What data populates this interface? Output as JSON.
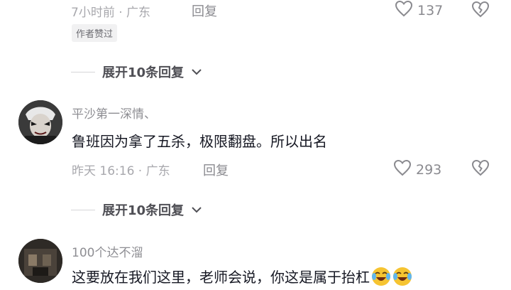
{
  "comment_top": {
    "meta": "7小时前 · 广东",
    "reply_label": "回复",
    "like_count": "137",
    "author_badge": "作者赞过"
  },
  "expand_1": {
    "label": "展开10条回复"
  },
  "comment_2": {
    "username": "平沙第一深情、",
    "content": "鲁班因为拿了五杀，极限翻盘。所以出名",
    "meta": "昨天 16:16 · 广东",
    "reply_label": "回复",
    "like_count": "293"
  },
  "expand_2": {
    "label": "展开10条回复"
  },
  "comment_3": {
    "username": "100个达不溜",
    "content": "这要放在我们这里，老师会说，你这是属于抬杠"
  },
  "colors": {
    "text_primary": "#161823",
    "text_meta": "#a8a8ad",
    "badge_bg": "#f1f1f2"
  }
}
